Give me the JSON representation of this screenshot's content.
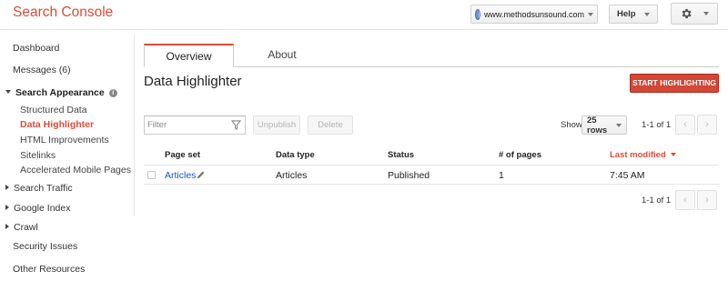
{
  "header": {
    "brand": "Search Console",
    "site": "www.methodsunsound.com",
    "help_label": "Help"
  },
  "sidebar": {
    "dashboard": "Dashboard",
    "messages": "Messages (6)",
    "search_appearance": "Search Appearance",
    "structured_data": "Structured Data",
    "data_highlighter": "Data Highlighter",
    "html_improvements": "HTML Improvements",
    "sitelinks": "Sitelinks",
    "amp": "Accelerated Mobile Pages",
    "search_traffic": "Search Traffic",
    "google_index": "Google Index",
    "crawl": "Crawl",
    "security_issues": "Security Issues",
    "other_resources": "Other Resources"
  },
  "tabs": {
    "overview": "Overview",
    "about": "About"
  },
  "main": {
    "title": "Data Highlighter",
    "start_button": "START HIGHLIGHTING"
  },
  "toolbar": {
    "filter_placeholder": "Filter",
    "unpublish": "Unpublish",
    "delete": "Delete",
    "show_label": "Show",
    "rows_select": "25 rows",
    "pager_text": "1-1 of 1"
  },
  "table": {
    "columns": [
      "Page set",
      "Data type",
      "Status",
      "# of pages",
      "Last modified"
    ],
    "rows": [
      {
        "page_set": "Articles",
        "data_type": "Articles",
        "status": "Published",
        "pages": "1",
        "last_modified": "7:45 AM"
      }
    ]
  },
  "footer_pager": {
    "text": "1-1 of 1"
  },
  "colors": {
    "brand": "#dd4b39",
    "link": "#1155cc",
    "button": "#d14836"
  }
}
